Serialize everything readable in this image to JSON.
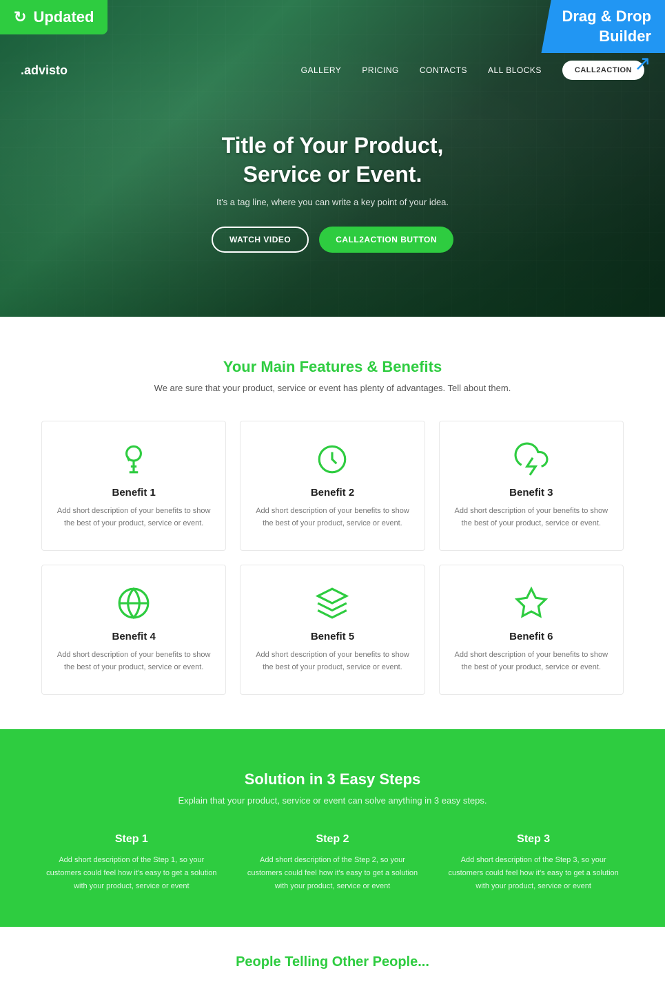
{
  "badges": {
    "updated_label": "Updated",
    "drag_drop_label": "Drag & Drop\nBuilder"
  },
  "navbar": {
    "logo_prefix": ".advis",
    "logo_suffix": "to",
    "links": [
      {
        "label": "GALLERY"
      },
      {
        "label": "PRICING"
      },
      {
        "label": "CONTACTS"
      },
      {
        "label": "ALL BLOCKS"
      }
    ],
    "cta_button": "CALL2ACTION"
  },
  "hero": {
    "title": "Title of Your Product,\nService or Event.",
    "tagline": "It's a tag line, where you can write a key point of your idea.",
    "watch_video_btn": "WATCH VIDEO",
    "cta_btn": "CALL2ACTION BUTTON"
  },
  "features": {
    "section_title": "Your Main Features & Benefits",
    "section_subtitle": "We are sure that your product, service or event has plenty of advantages. Tell about them.",
    "benefits": [
      {
        "title": "Benefit 1",
        "desc": "Add short description of your benefits to show the best of your product, service or event.",
        "icon": "lightbulb"
      },
      {
        "title": "Benefit 2",
        "desc": "Add short description of your benefits to show the best of your product, service or event.",
        "icon": "clock"
      },
      {
        "title": "Benefit 3",
        "desc": "Add short description of your benefits to show the best of your product, service or event.",
        "icon": "cloud-lightning"
      },
      {
        "title": "Benefit 4",
        "desc": "Add short description of your benefits to show the best of your product, service or event.",
        "icon": "globe"
      },
      {
        "title": "Benefit 5",
        "desc": "Add short description of your benefits to show the best of your product, service or event.",
        "icon": "layers"
      },
      {
        "title": "Benefit 6",
        "desc": "Add short description of your benefits to show the best of your product, service or event.",
        "icon": "star"
      }
    ]
  },
  "steps": {
    "section_title": "Solution in 3 Easy Steps",
    "section_subtitle": "Explain that your product, service or event can solve anything in 3 easy steps.",
    "items": [
      {
        "title": "Step 1",
        "desc": "Add short description of the Step 1, so your customers could feel how it's easy to get a solution with your product, service or event"
      },
      {
        "title": "Step 2",
        "desc": "Add short description of the Step 2, so your customers could feel how it's easy to get a solution with your product, service or event"
      },
      {
        "title": "Step 3",
        "desc": "Add short description of the Step 3, so your customers could feel how it's easy to get a solution with your product, service or event"
      }
    ]
  },
  "bottom_teaser": {
    "text": "People Telling Other People..."
  },
  "colors": {
    "green": "#2ecc40",
    "blue": "#2196f3",
    "dark": "#222222",
    "text_muted": "#777777"
  }
}
